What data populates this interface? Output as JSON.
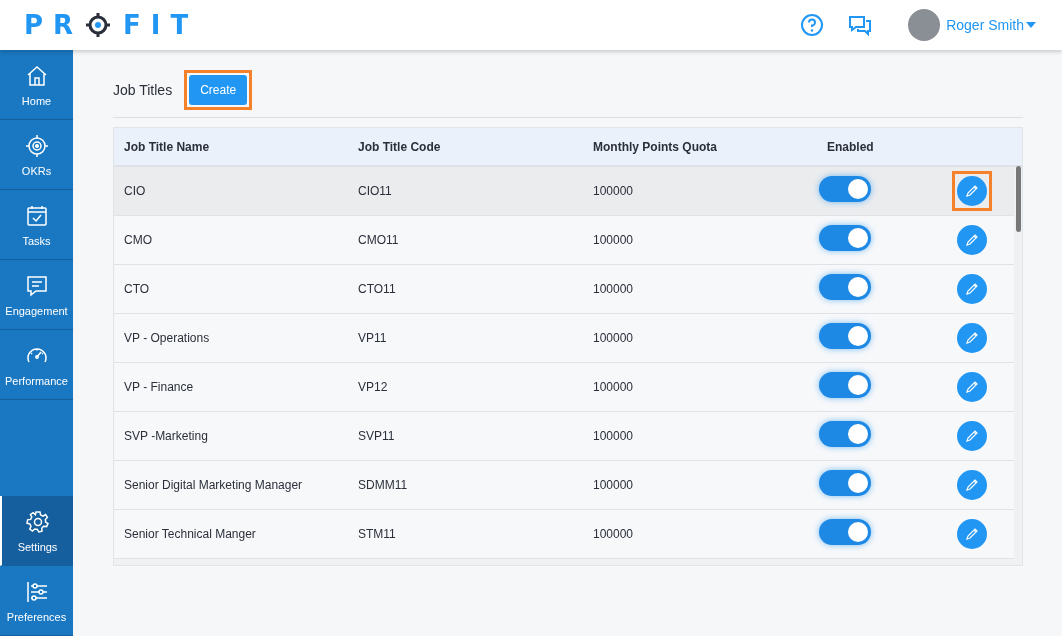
{
  "header": {
    "logo": {
      "before": "PR",
      "after": "FIT"
    },
    "user": {
      "name": "Roger Smith"
    }
  },
  "sidebar": {
    "items": [
      {
        "label": "Home",
        "selected": false
      },
      {
        "label": "OKRs",
        "selected": false
      },
      {
        "label": "Tasks",
        "selected": false
      },
      {
        "label": "Engagement",
        "selected": false
      },
      {
        "label": "Performance",
        "selected": false
      }
    ],
    "bottom_items": [
      {
        "label": "Settings",
        "selected": true
      },
      {
        "label": "Preferences",
        "selected": false
      }
    ]
  },
  "page": {
    "title": "Job Titles",
    "create_button": {
      "label": "Create",
      "highlighted": true
    }
  },
  "table": {
    "columns": [
      "Job Title Name",
      "Job Title Code",
      "Monthly Points Quota",
      "Enabled"
    ],
    "rows": [
      {
        "name": "CIO",
        "code": "CIO11",
        "quota": "100000",
        "enabled": true,
        "hovered": true,
        "edit_highlighted": true
      },
      {
        "name": "CMO",
        "code": "CMO11",
        "quota": "100000",
        "enabled": true,
        "hovered": false,
        "edit_highlighted": false
      },
      {
        "name": "CTO",
        "code": "CTO11",
        "quota": "100000",
        "enabled": true,
        "hovered": false,
        "edit_highlighted": false
      },
      {
        "name": "VP - Operations",
        "code": "VP11",
        "quota": "100000",
        "enabled": true,
        "hovered": false,
        "edit_highlighted": false
      },
      {
        "name": "VP - Finance",
        "code": "VP12",
        "quota": "100000",
        "enabled": true,
        "hovered": false,
        "edit_highlighted": false
      },
      {
        "name": "SVP -Marketing",
        "code": "SVP11",
        "quota": "100000",
        "enabled": true,
        "hovered": false,
        "edit_highlighted": false
      },
      {
        "name": "Senior Digital Marketing Manager",
        "code": "SDMM11",
        "quota": "100000",
        "enabled": true,
        "hovered": false,
        "edit_highlighted": false
      },
      {
        "name": "Senior Technical Manger",
        "code": "STM11",
        "quota": "100000",
        "enabled": true,
        "hovered": false,
        "edit_highlighted": false
      }
    ]
  }
}
